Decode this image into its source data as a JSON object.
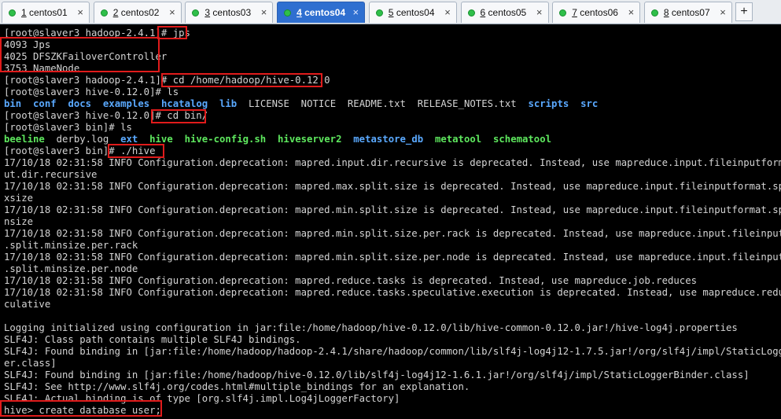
{
  "tabs": [
    {
      "num": "1",
      "name": "centos01"
    },
    {
      "num": "2",
      "name": "centos02"
    },
    {
      "num": "3",
      "name": "centos03"
    },
    {
      "num": "4",
      "name": "centos04"
    },
    {
      "num": "5",
      "name": "centos04"
    },
    {
      "num": "6",
      "name": "centos05"
    },
    {
      "num": "7",
      "name": "centos06"
    },
    {
      "num": "8",
      "name": "centos07"
    }
  ],
  "active_tab": 3,
  "add_tab_label": "+",
  "close_label": "×",
  "terminal": {
    "lines": [
      "[root@slaver3 hadoop-2.4.1]# jps",
      "4093 Jps",
      "4025 DFSZKFailoverController",
      "3753 NameNode",
      "[root@slaver3 hadoop-2.4.1]# cd /home/hadoop/hive-0.12.0",
      "[root@slaver3 hive-0.12.0]# ls",
      "",
      "[root@slaver3 hive-0.12.0]# cd bin/",
      "[root@slaver3 bin]# ls",
      "",
      "[root@slaver3 bin]# ./hive",
      "17/10/18 02:31:58 INFO Configuration.deprecation: mapred.input.dir.recursive is deprecated. Instead, use mapreduce.input.fileinputformat.inp",
      "ut.dir.recursive",
      "17/10/18 02:31:58 INFO Configuration.deprecation: mapred.max.split.size is deprecated. Instead, use mapreduce.input.fileinputformat.split.ma",
      "xsize",
      "17/10/18 02:31:58 INFO Configuration.deprecation: mapred.min.split.size is deprecated. Instead, use mapreduce.input.fileinputformat.split.mi",
      "nsize",
      "17/10/18 02:31:58 INFO Configuration.deprecation: mapred.min.split.size.per.rack is deprecated. Instead, use mapreduce.input.fileinputformat",
      ".split.minsize.per.rack",
      "17/10/18 02:31:58 INFO Configuration.deprecation: mapred.min.split.size.per.node is deprecated. Instead, use mapreduce.input.fileinputformat",
      ".split.minsize.per.node",
      "17/10/18 02:31:58 INFO Configuration.deprecation: mapred.reduce.tasks is deprecated. Instead, use mapreduce.job.reduces",
      "17/10/18 02:31:58 INFO Configuration.deprecation: mapred.reduce.tasks.speculative.execution is deprecated. Instead, use mapreduce.reduce.spe",
      "culative",
      "",
      "Logging initialized using configuration in jar:file:/home/hadoop/hive-0.12.0/lib/hive-common-0.12.0.jar!/hive-log4j.properties",
      "SLF4J: Class path contains multiple SLF4J bindings.",
      "SLF4J: Found binding in [jar:file:/home/hadoop/hadoop-2.4.1/share/hadoop/common/lib/slf4j-log4j12-1.7.5.jar!/org/slf4j/impl/StaticLoggerBind",
      "er.class]",
      "SLF4J: Found binding in [jar:file:/home/hadoop/hive-0.12.0/lib/slf4j-log4j12-1.6.1.jar!/org/slf4j/impl/StaticLoggerBinder.class]",
      "SLF4J: See http://www.slf4j.org/codes.html#multiple_bindings for an explanation.",
      "SLF4J: Actual binding is of type [org.slf4j.impl.Log4jLoggerFactory]",
      "hive> create database user;"
    ],
    "ls_hive_root": [
      {
        "t": "bin",
        "c": "b"
      },
      {
        "t": "conf",
        "c": "b"
      },
      {
        "t": "docs",
        "c": "b"
      },
      {
        "t": "examples",
        "c": "b"
      },
      {
        "t": "hcatalog",
        "c": "b"
      },
      {
        "t": "lib",
        "c": "b"
      },
      {
        "t": "LICENSE",
        "c": "w"
      },
      {
        "t": "NOTICE",
        "c": "w"
      },
      {
        "t": "README.txt",
        "c": "w"
      },
      {
        "t": "RELEASE_NOTES.txt",
        "c": "w"
      },
      {
        "t": "scripts",
        "c": "b"
      },
      {
        "t": "src",
        "c": "b"
      }
    ],
    "ls_bin": [
      {
        "t": "beeline",
        "c": "g"
      },
      {
        "t": "derby.log",
        "c": "w"
      },
      {
        "t": "ext",
        "c": "b"
      },
      {
        "t": "hive",
        "c": "g"
      },
      {
        "t": "hive-config.sh",
        "c": "g"
      },
      {
        "t": "hiveserver2",
        "c": "g"
      },
      {
        "t": "metastore_db",
        "c": "b"
      },
      {
        "t": "metatool",
        "c": "g"
      },
      {
        "t": "schematool",
        "c": "g"
      }
    ]
  },
  "colors": {
    "highlight": "#e01b1b",
    "directory": "#5aa9ff",
    "executable": "#5ee85e",
    "active_tab": "#2f6fd0"
  }
}
